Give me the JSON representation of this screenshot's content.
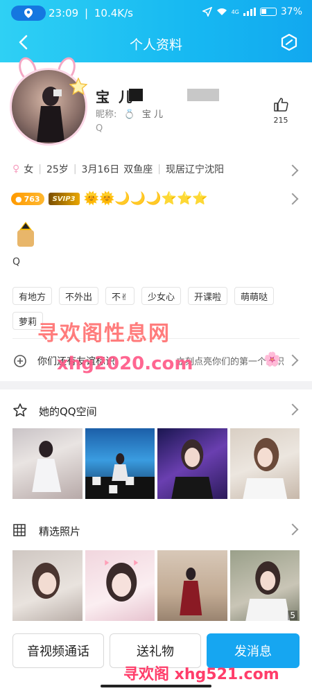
{
  "status_bar": {
    "time": "23:09",
    "speed": "10.4K/s",
    "signal": "4G",
    "battery": "37%"
  },
  "nav": {
    "title": "个人资料"
  },
  "profile": {
    "name_visible": "宝 儿",
    "nickname_label": "昵称:",
    "nickname_value": "宝 儿",
    "qq_letter": "Q",
    "likes": "215"
  },
  "info": {
    "gender": "女",
    "age": "25岁",
    "birthday": "3月16日",
    "zodiac": "双鱼座",
    "location": "现居辽宁沈阳"
  },
  "badges": {
    "level_points": "763",
    "svip": "SVIP3",
    "level_icons": "🌞🌞🌙🌙🌙⭐⭐⭐"
  },
  "q_letter_2": "Q",
  "tags": [
    "有地方",
    "不外出",
    "不✌",
    "少女心",
    "开课啦",
    "萌萌哒",
    "萝莉"
  ],
  "friend_row": {
    "left_text": "你们还有友谊标识",
    "right_text": "立刻点亮你们的第一个标识"
  },
  "watermarks": {
    "top": "寻欢阁性息网",
    "middle": "xhg2020.com",
    "bottom": "寻欢阁 xhg521.com"
  },
  "qzone": {
    "title": "她的QQ空间"
  },
  "photos": {
    "title": "精选照片",
    "count": "5"
  },
  "buttons": {
    "call": "音视频通话",
    "gift": "送礼物",
    "message": "发消息"
  },
  "colors": {
    "header_start": "#2fd0f4",
    "header_end": "#12a8ef",
    "primary": "#16a6f1",
    "watermark": "#ff5a88"
  }
}
